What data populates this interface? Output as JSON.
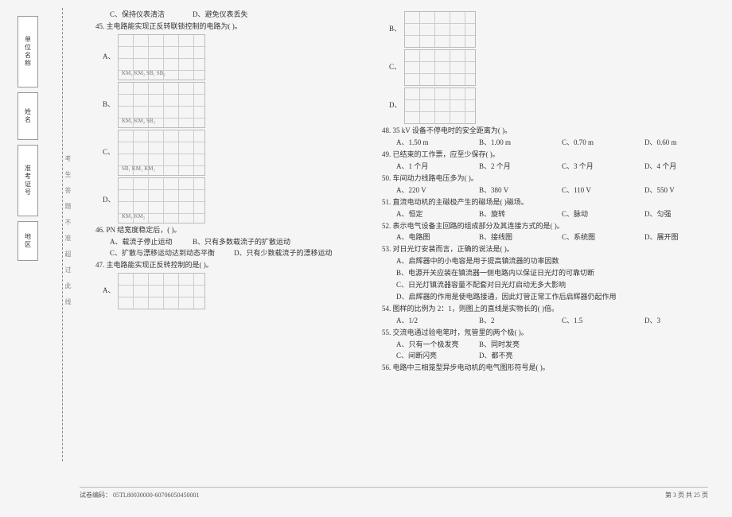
{
  "sidebar": {
    "boxes": [
      {
        "label": "单位名称",
        "cls": "tall"
      },
      {
        "label": "姓名",
        "cls": "med"
      },
      {
        "label": "准考证号",
        "cls": "tall"
      },
      {
        "label": "地区",
        "cls": "short"
      }
    ]
  },
  "strip_text": "考生答题不准超过此线",
  "left": {
    "pre44": {
      "c": "C、保持仪表清洁",
      "d": "D、避免仪表丢失"
    },
    "q45": "45. 主电路能实现正反转联锁控制的电路为(    )。",
    "opt45": {
      "a": "A、",
      "b": "B、",
      "c": "C、",
      "d": "D、"
    },
    "diag_labels": {
      "a": "KM₁ KM₂ SB₁ SB₂",
      "b": "KM₁ KM₂ SB₂",
      "c": "SB₁ KM₁ KM₂",
      "d": "KM₁ KM₂"
    },
    "q46": "46. PN 结宽度稳定后，(    )。",
    "q46a": "A、载流子停止运动",
    "q46b": "B、只有多数载流子的扩散运动",
    "q46c": "C、扩散与漂移运动达到动态平衡",
    "q46d": "D、只有少数载流子的漂移运动",
    "q47": "47. 主电路能实现正反转控制的是(    )。",
    "opt47a": "A、"
  },
  "right": {
    "opt47b": "B、",
    "opt47c": "C、",
    "opt47d": "D、",
    "q48": "48. 35 kV 设备不停电时的安全距离为(    )。",
    "q48opts": {
      "a": "A、1.50 m",
      "b": "B、1.00 m",
      "c": "C、0.70 m",
      "d": "D、0.60 m"
    },
    "q49": "49. 已结束的工作票，应至少保存(    )。",
    "q49opts": {
      "a": "A、1 个月",
      "b": "B、2 个月",
      "c": "C、3 个月",
      "d": "D、4 个月"
    },
    "q50": "50. 车间动力线路电压多为(    )。",
    "q50opts": {
      "a": "A、220 V",
      "b": "B、380 V",
      "c": "C、110 V",
      "d": "D、550 V"
    },
    "q51": "51. 直流电动机的主磁极产生的磁场是(    )磁场。",
    "q51opts": {
      "a": "A、恒定",
      "b": "B、旋转",
      "c": "C、脉动",
      "d": "D、匀强"
    },
    "q52": "52. 表示电气设备主回路的组成部分及其连接方式的是(    )。",
    "q52opts": {
      "a": "A、电路图",
      "b": "B、接线图",
      "c": "C、系统图",
      "d": "D、展开图"
    },
    "q53": "53. 对日光灯安装而言，正确的说法是(    )。",
    "q53a": "A、启辉器中的小电容是用于提高镇流器的功率因数",
    "q53b": "B、电源开关应装在镇流器一侧电路内以保证日光灯的可靠切断",
    "q53c": "C、日光灯镇流器容量不配套对日光灯启动无多大影响",
    "q53d": "D、启辉器的作用是使电路接通，因此灯管正常工作后启辉器仍起作用",
    "q54": "54. 图样的比例为 2：1，则图上的直线是实物长的(    )倍。",
    "q54opts": {
      "a": "A、1/2",
      "b": "B、2",
      "c": "C、1.5",
      "d": "D、3"
    },
    "q55": "55. 交流电通过验电笔时，氖管里的两个极(    )。",
    "q55a": "A、只有一个极发亮",
    "q55b": "B、同时发亮",
    "q55c": "C、间断闪亮",
    "q55d": "D、都不亮",
    "q56": "56. 电路中三相笼型异步电动机的电气图形符号是(    )。"
  },
  "footer": {
    "code_label": "试卷编码：",
    "code": "05TL80030000-60706050450001",
    "page": "第 3 页  共 25 页"
  }
}
